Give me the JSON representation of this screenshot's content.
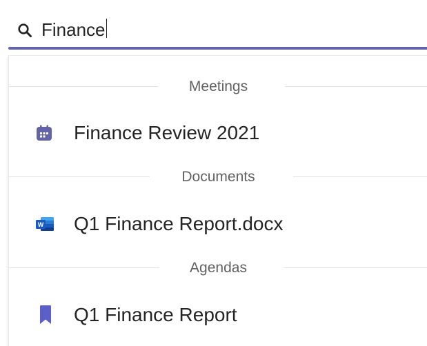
{
  "search": {
    "value": "Finance",
    "icon": "search-icon"
  },
  "colors": {
    "accent": "#6264a7",
    "text_primary": "#242424",
    "text_secondary": "#616161",
    "calendar_icon": "#6264a7",
    "bookmark_icon": "#5b5fc7",
    "word_blue": "#185abd"
  },
  "sections": [
    {
      "title": "Meetings",
      "items": [
        {
          "label": "Finance Review 2021",
          "icon": "calendar-icon"
        }
      ]
    },
    {
      "title": "Documents",
      "items": [
        {
          "label": "Q1 Finance Report.docx",
          "icon": "word-document-icon"
        }
      ]
    },
    {
      "title": "Agendas",
      "items": [
        {
          "label": "Q1 Finance Report",
          "icon": "bookmark-icon"
        }
      ]
    }
  ]
}
